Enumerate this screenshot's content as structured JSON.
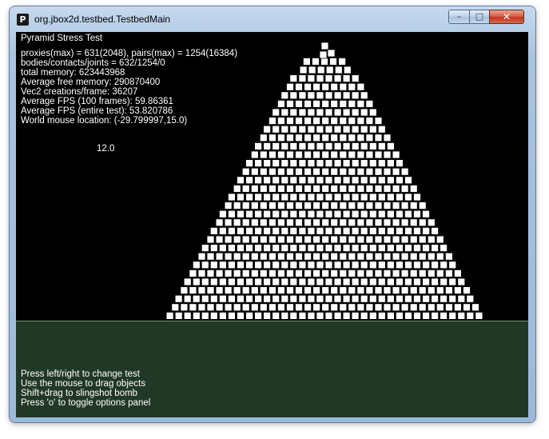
{
  "window": {
    "title": "org.jbox2d.testbed.TestbedMain",
    "icon": "P",
    "buttons": {
      "minimize": "minimize-icon",
      "maximize": "maximize-icon",
      "close": "close-icon"
    }
  },
  "test": {
    "name": "Pyramid Stress Test",
    "stats": [
      "proxies(max) = 631(2048), pairs(max) = 1254(16384)",
      "bodies/contacts/joints = 632/1254/0",
      "total memory: 623443968",
      "Average free memory: 290870400",
      "Vec2 creations/frame: 36207",
      "Average FPS (100 frames): 59.86361",
      "Average FPS (entire test): 53.820786",
      "World mouse location: (-29.799997,15.0)"
    ],
    "value_label": "12.0"
  },
  "instructions": [
    "Press left/right to change test",
    "Use the mouse to drag objects",
    "Shift+drag to slingshot bomb",
    "Press 'o' to toggle options panel"
  ],
  "colors": {
    "canvas_bg": "#000000",
    "ground_fill": "#223826",
    "ground_edge": "#6f9a7a",
    "box_fill": "#ffffff",
    "box_outline": "#000000",
    "text": "#ffffff"
  }
}
